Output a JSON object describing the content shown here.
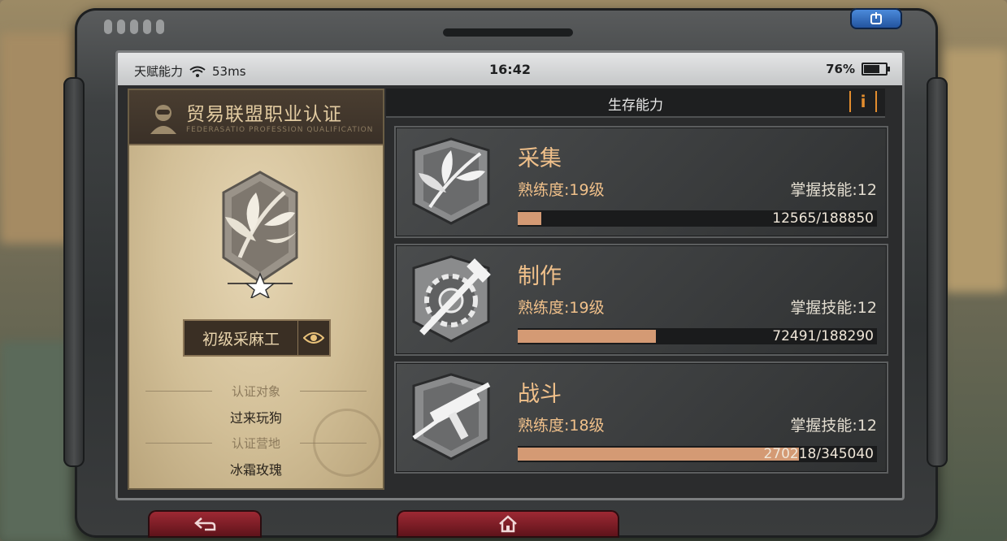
{
  "status_bar": {
    "carrier": "天赋能力",
    "latency": "53ms",
    "time": "16:42",
    "battery": "76%",
    "battery_level": 0.76
  },
  "card": {
    "title": "贸易联盟职业认证",
    "subtitle": "FEDERASATIO PROFESSION QUALIFICATION",
    "rank": "初级采麻工",
    "target_label": "认证对象",
    "target_value": "过来玩狗",
    "camp_label": "认证营地",
    "camp_value": "冰霜玫瑰"
  },
  "panel": {
    "title": "生存能力",
    "info_label": "i"
  },
  "skills": [
    {
      "name": "采集",
      "proficiency": "熟练度:19级",
      "mastery": "掌握技能:12",
      "progress_text": "12565/188850",
      "current": 12565,
      "max": 188850,
      "icon": "leaf-bundle-icon"
    },
    {
      "name": "制作",
      "proficiency": "熟练度:19级",
      "mastery": "掌握技能:12",
      "progress_text": "72491/188290",
      "current": 72491,
      "max": 188290,
      "icon": "gear-hammer-icon"
    },
    {
      "name": "战斗",
      "proficiency": "熟练度:18级",
      "mastery": "掌握技能:12",
      "progress_text": "270218/345040",
      "current": 270218,
      "max": 345040,
      "icon": "submachine-gun-icon"
    }
  ],
  "colors": {
    "accent": "#f0c08a",
    "bar_fill": "#d49a74",
    "info_orange": "#e38d2e",
    "back_button": "#a12a35"
  }
}
